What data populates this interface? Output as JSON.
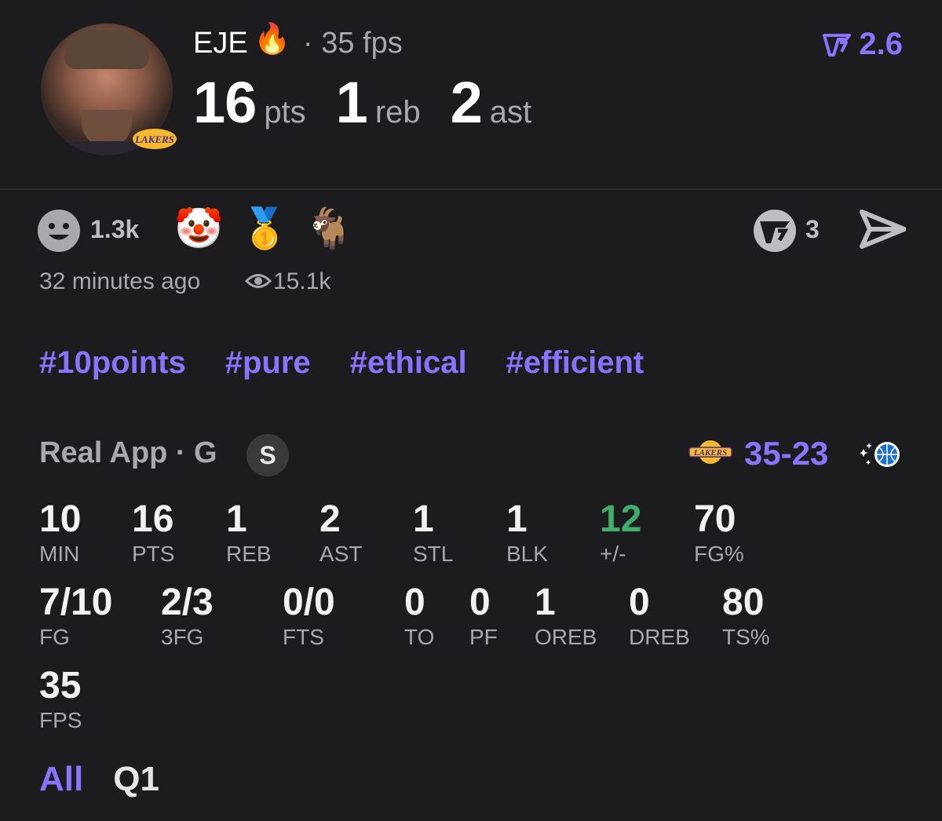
{
  "header": {
    "name": "EJE",
    "name_emoji": "🔥",
    "fps_line": "· 35 fps",
    "rating": "2.6",
    "rating_icon": "v-rank-icon",
    "stats": [
      {
        "value": "16",
        "unit": "pts"
      },
      {
        "value": "1",
        "unit": "reb"
      },
      {
        "value": "2",
        "unit": "ast"
      }
    ]
  },
  "reactions": {
    "count": "1.3k",
    "emojis": [
      "🤡",
      "🥇",
      "🐐"
    ],
    "shield_count": "3"
  },
  "meta": {
    "time_ago": "32 minutes ago",
    "views": "15.1k"
  },
  "tags": [
    "#10points",
    "#pure",
    "#ethical",
    "#efficient"
  ],
  "game": {
    "source": "Real App · G",
    "badge": "S",
    "score": "35-23"
  },
  "stats_row1": [
    {
      "value": "10",
      "label": "MIN"
    },
    {
      "value": "16",
      "label": "PTS"
    },
    {
      "value": "1",
      "label": "REB"
    },
    {
      "value": "2",
      "label": "AST"
    },
    {
      "value": "1",
      "label": "STL"
    },
    {
      "value": "1",
      "label": "BLK"
    },
    {
      "value": "12",
      "label": "+/-"
    },
    {
      "value": "70",
      "label": "FG%"
    }
  ],
  "stats_row2": [
    {
      "value": "7/10",
      "label": "FG"
    },
    {
      "value": "2/3",
      "label": "3FG"
    },
    {
      "value": "0/0",
      "label": "FTS"
    },
    {
      "value": "0",
      "label": "TO"
    },
    {
      "value": "0",
      "label": "PF"
    },
    {
      "value": "1",
      "label": "OREB"
    },
    {
      "value": "0",
      "label": "DREB"
    },
    {
      "value": "80",
      "label": "TS%"
    }
  ],
  "stats_row3": [
    {
      "value": "35",
      "label": "FPS"
    }
  ],
  "tabs": {
    "all": "All",
    "q1": "Q1"
  },
  "colors": {
    "accent": "#8b73ff",
    "positive": "#3fae6a",
    "background": "#1c1c1e"
  }
}
